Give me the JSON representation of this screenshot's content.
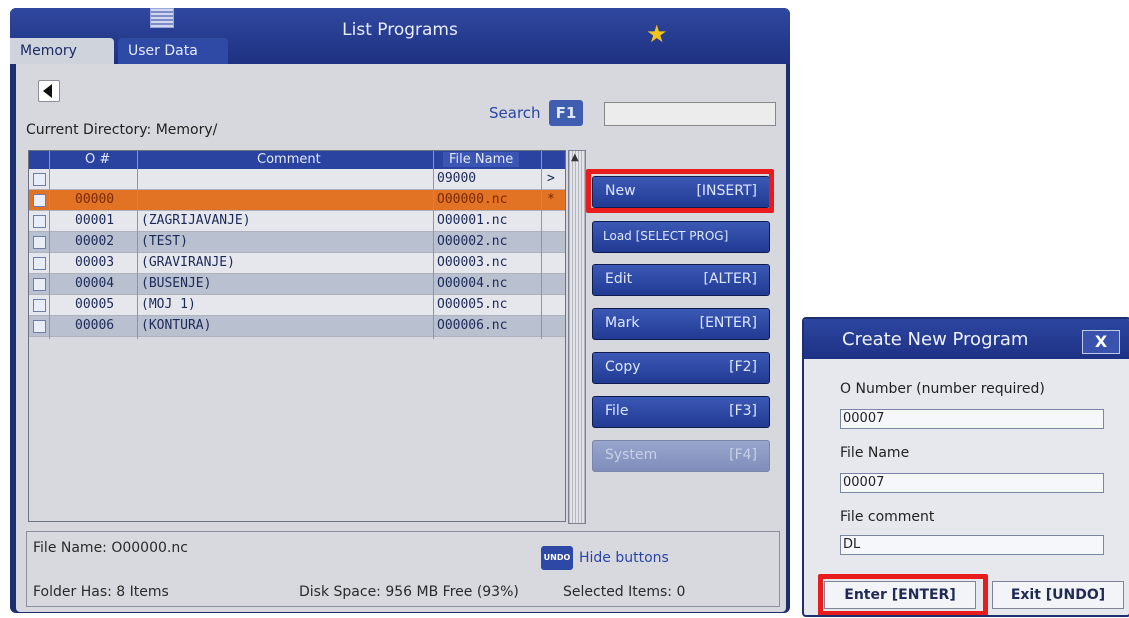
{
  "main_window": {
    "title": "List Programs",
    "tabs": [
      "Memory",
      "User Data"
    ],
    "current_directory": "Current Directory: Memory/",
    "search": {
      "label": "Search",
      "key": "F1",
      "value": ""
    },
    "table": {
      "columns": [
        "O #",
        "Comment",
        "File Name"
      ],
      "rows": [
        {
          "num": "",
          "comment": "",
          "file": "09000",
          "marker": ">"
        },
        {
          "num": "00000",
          "comment": "",
          "file": "O00000.nc",
          "marker": "*"
        },
        {
          "num": "00001",
          "comment": "(ZAGRIJAVANJE)",
          "file": "O00001.nc",
          "marker": ""
        },
        {
          "num": "00002",
          "comment": "(TEST)",
          "file": "O00002.nc",
          "marker": ""
        },
        {
          "num": "00003",
          "comment": "(GRAVIRANJE)",
          "file": "O00003.nc",
          "marker": ""
        },
        {
          "num": "00004",
          "comment": "(BUSENJE)",
          "file": "O00004.nc",
          "marker": ""
        },
        {
          "num": "00005",
          "comment": "(MOJ 1)",
          "file": "O00005.nc",
          "marker": ""
        },
        {
          "num": "00006",
          "comment": "(KONTURA)",
          "file": "O00006.nc",
          "marker": ""
        }
      ]
    },
    "buttons": {
      "new": {
        "label": "New",
        "key": "[INSERT]"
      },
      "load": {
        "label": "Load [SELECT PROG]"
      },
      "edit": {
        "label": "Edit",
        "key": "[ALTER]"
      },
      "mark": {
        "label": "Mark",
        "key": "[ENTER]"
      },
      "copy": {
        "label": "Copy",
        "key": "[F2]"
      },
      "file": {
        "label": "File",
        "key": "[F3]"
      },
      "system": {
        "label": "System",
        "key": "[F4]"
      }
    },
    "footer": {
      "file_name": "File Name: O00000.nc",
      "undo_key": "UNDO",
      "hide_buttons": "Hide buttons",
      "folder_items": "Folder Has: 8 Items",
      "disk_space": "Disk Space: 956 MB Free (93%)",
      "selected_items": "Selected Items: 0"
    }
  },
  "dialog": {
    "title": "Create New Program",
    "close": "X",
    "o_number_label": "O Number (number required)",
    "o_number_value": "00007",
    "file_name_label": "File Name",
    "file_name_value": "00007",
    "comment_label": "File comment",
    "comment_value": "DL",
    "enter_button": "Enter [ENTER]",
    "exit_button": "Exit [UNDO]"
  },
  "colors": {
    "highlight": "#e81c1c",
    "selected_row": "#e27224",
    "window_blue": "#1c2f6e",
    "button_blue": "#2d49a5"
  }
}
